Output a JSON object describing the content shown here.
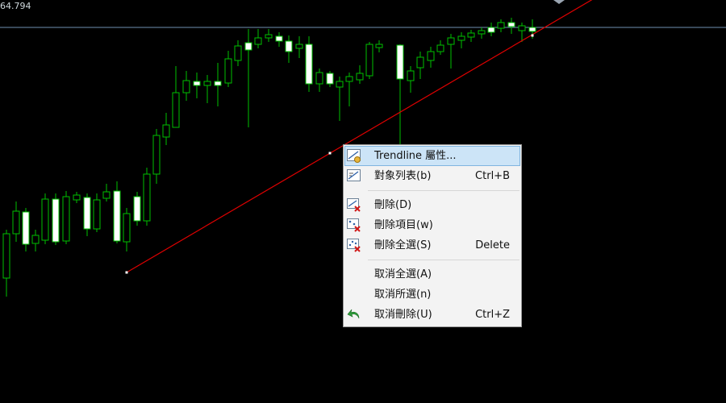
{
  "chart": {
    "price_label": "64.794",
    "colors": {
      "background": "#000000",
      "candle": "#00c000",
      "bull_body": "#000000",
      "bear_body": "#ffffff",
      "trendline": "#e00000",
      "price_line": "#6f8fb0"
    }
  },
  "context_menu": {
    "items": [
      {
        "label": "Trendline 屬性...",
        "shortcut": "",
        "icon": "trendline-properties-icon",
        "highlighted": true
      },
      {
        "label": "對象列表(b)",
        "shortcut": "Ctrl+B",
        "icon": "object-list-icon"
      },
      {
        "separator": true
      },
      {
        "label": "刪除(D)",
        "shortcut": "",
        "icon": "delete-icon"
      },
      {
        "label": "刪除項目(w)",
        "shortcut": "",
        "icon": "delete-item-icon"
      },
      {
        "label": "刪除全選(S)",
        "shortcut": "Delete",
        "icon": "delete-all-selected-icon"
      },
      {
        "separator": true
      },
      {
        "label": "取消全選(A)",
        "shortcut": "",
        "icon": ""
      },
      {
        "label": "取消所選(n)",
        "shortcut": "",
        "icon": ""
      },
      {
        "label": "取消刪除(U)",
        "shortcut": "Ctrl+Z",
        "icon": "undo-delete-icon"
      }
    ]
  }
}
